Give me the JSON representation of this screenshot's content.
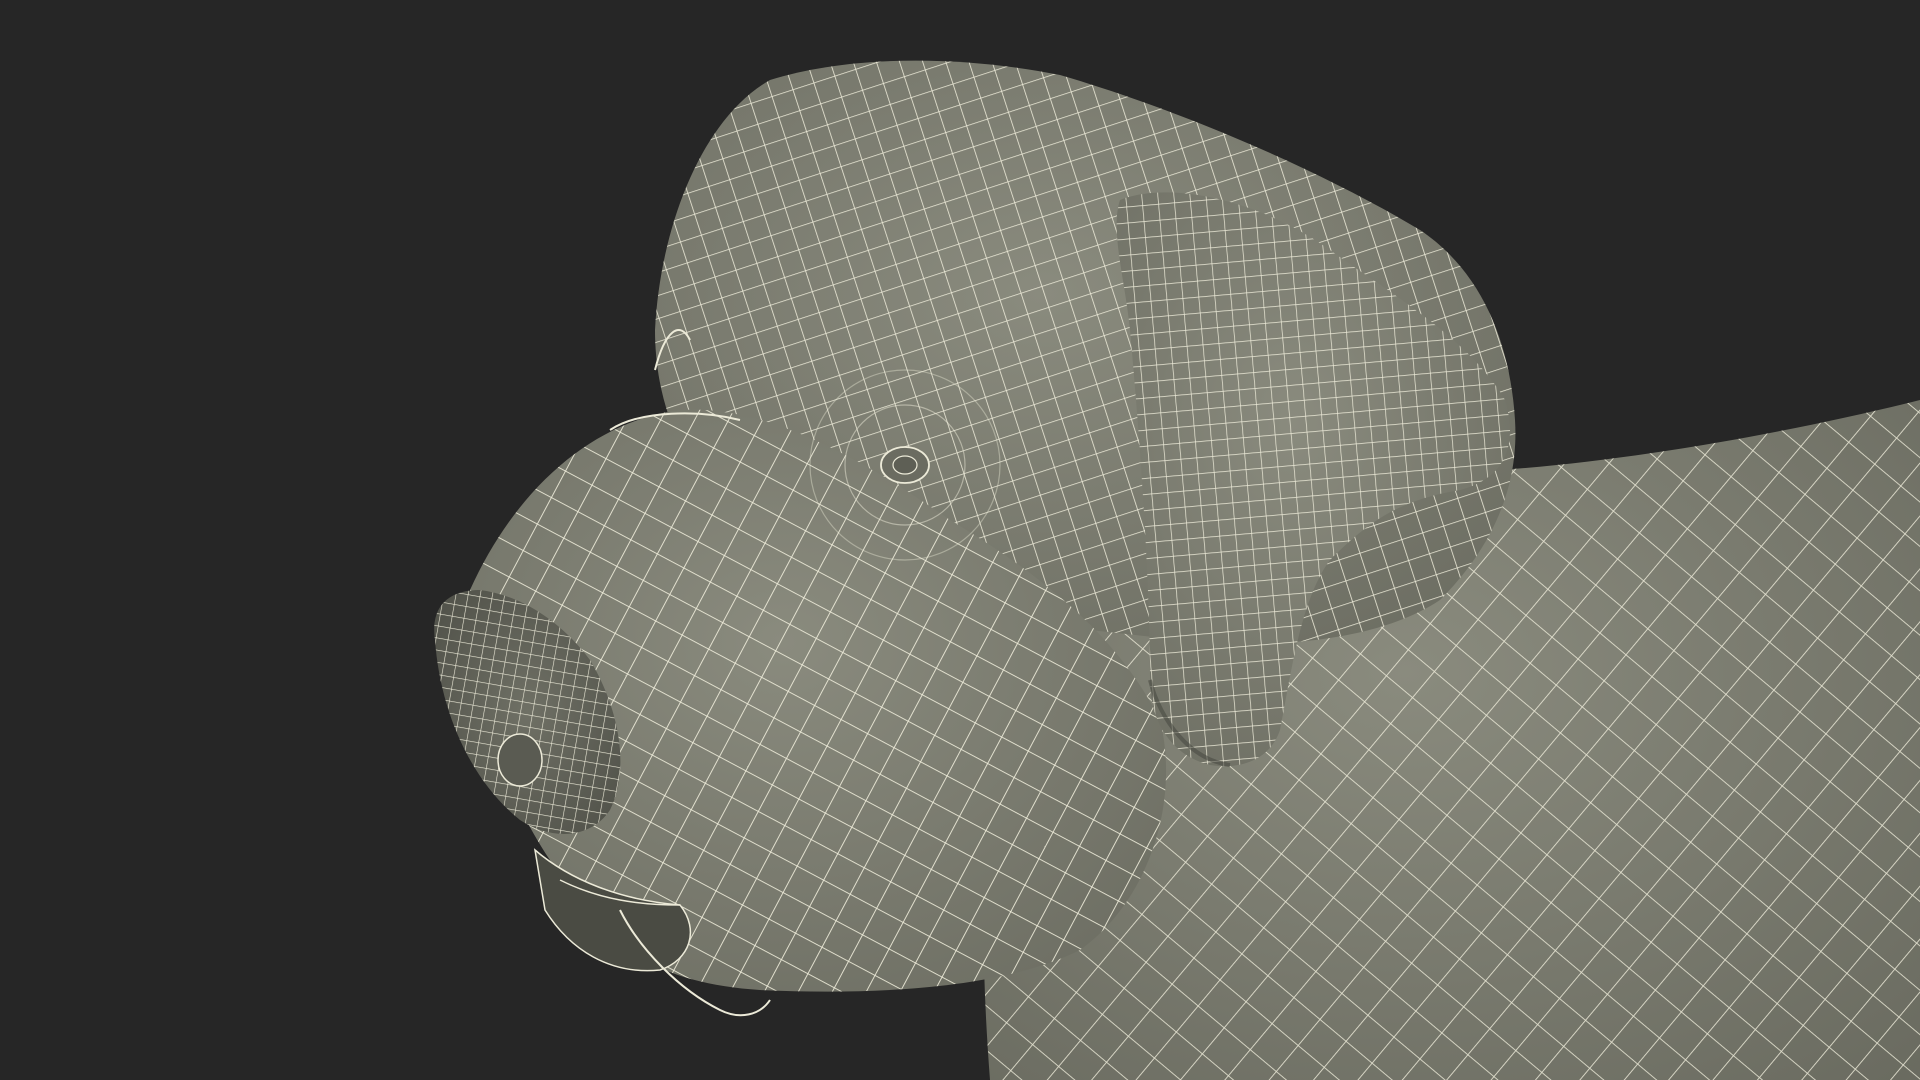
{
  "scene": {
    "subject": "dog-head-wireframe",
    "colors": {
      "background": "#262626",
      "mesh_fill": "#7b7c6f",
      "mesh_fill_light": "#8a8b7e",
      "mesh_fill_dark": "#5d5e54",
      "wire": "#ecead8",
      "shadow": "#4a4b43"
    }
  }
}
